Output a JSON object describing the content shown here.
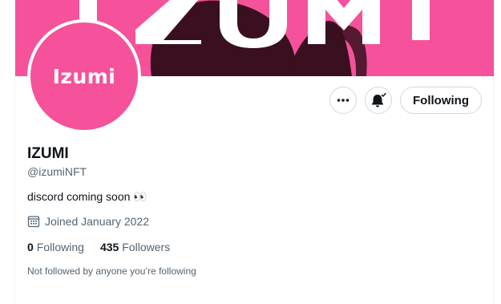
{
  "banner": {
    "text": "IZUMI",
    "color": "#f5529b"
  },
  "avatar": {
    "text": "Izumi",
    "color": "#f5529b"
  },
  "actions": {
    "more_icon": "more-horizontal-icon",
    "notify_icon": "bell-subscribed-icon",
    "following_label": "Following"
  },
  "profile": {
    "display_name": "IZUMI",
    "handle": "@izumiNFT",
    "bio": "discord coming soon 👀",
    "joined": "Joined January 2022",
    "joined_icon": "calendar-icon",
    "following_count": "0",
    "following_label": "Following",
    "followers_count": "435",
    "followers_label": "Followers",
    "not_followed_text": "Not followed by anyone you’re following"
  }
}
